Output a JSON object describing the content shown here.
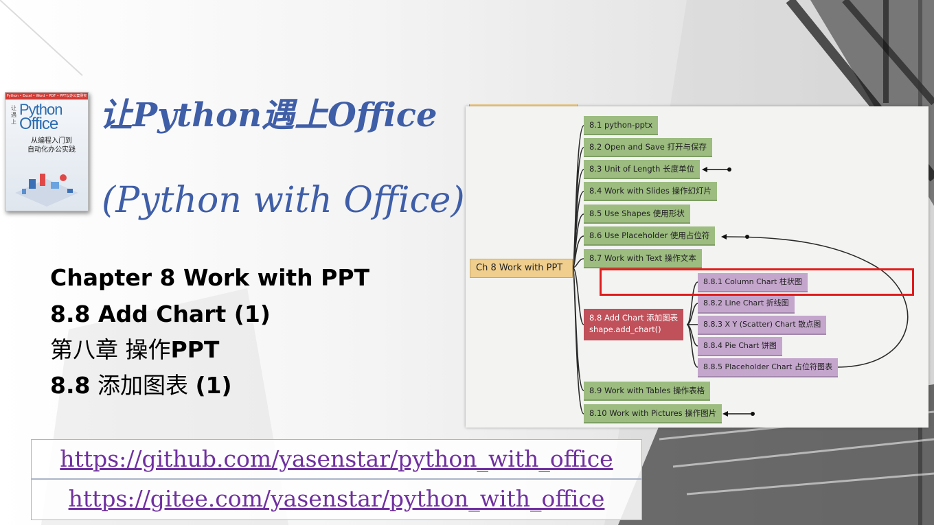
{
  "slide": {
    "title_cn": "让Python遇上Office",
    "title_en": "(Python with Office)",
    "lines": [
      {
        "text": "Chapter 8 Work with PPT"
      },
      {
        "text": "8.8 Add Chart (1)"
      },
      {
        "cn": "第八章 操作",
        "en": "PPT"
      },
      {
        "num": "8.8",
        "cn": " 添加图表 ",
        "paren": "(1)"
      }
    ],
    "links": [
      "https://github.com/yasenstar/python_with_office",
      "https://gitee.com/yasenstar/python_with_office"
    ]
  },
  "book": {
    "top_strip": "Python • Excel • Word • PDF • PPT以办公案例实践",
    "vertical": "让遇上",
    "python": "Python",
    "office": "Office",
    "subtitle_1": "从编程入门到",
    "subtitle_2": "自动化办公实践"
  },
  "mindmap": {
    "root": "Ch 8 Work with PPT",
    "nodes": [
      "8.1 python-pptx",
      "8.2 Open and Save 打开与保存",
      "8.3 Unit of Length 长度单位",
      "8.4 Work with Slides 操作幻灯片",
      "8.5 Use Shapes 使用形状",
      "8.6 Use Placeholder 使用占位符",
      "8.7 Work with Text 操作文本",
      "8.9 Work with Tables 操作表格",
      "8.10 Work with Pictures 操作图片"
    ],
    "add_chart": {
      "line1": "8.8 Add Chart 添加图表",
      "line2": "shape.add_chart()"
    },
    "subnodes": [
      "8.8.1 Column Chart 柱状图",
      "8.8.2 Line Chart 折线图",
      "8.8.3 X Y (Scatter) Chart 散点图",
      "8.8.4 Pie Chart 饼图",
      "8.8.5 Placeholder Chart 占位符图表"
    ]
  },
  "colors": {
    "title": "#3f5ea8",
    "link": "#7030a0",
    "highlight": "#e01b1b",
    "green_node": "#9cbc80",
    "purple_node": "#c4a6cc",
    "root_node": "#f0cf8e",
    "red_node": "#c0505a"
  }
}
